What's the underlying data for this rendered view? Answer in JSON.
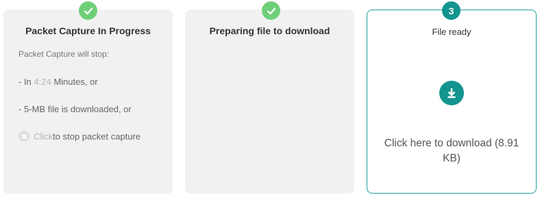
{
  "steps": [
    {
      "badge_icon": "checkmark-icon",
      "title": "Packet Capture In Progress",
      "lines": {
        "intro": "Packet Capture will stop:",
        "time_prefix": "- In ",
        "time_value": "4:24",
        "time_suffix": " Minutes, or",
        "size_text": "- 5-MB file is downloaded, or",
        "stop_link": "Click",
        "stop_suffix": " to stop packet capture"
      }
    },
    {
      "badge_icon": "checkmark-icon",
      "title": "Preparing file to download"
    },
    {
      "badge_number": "3",
      "title": "File ready",
      "download_icon": "download-icon",
      "download_text": "Click here to download (8.91 KB)"
    }
  ],
  "colors": {
    "completed_badge": "#6fcf78",
    "accent": "#13948f",
    "card_background": "#f1f1f1",
    "active_border": "#1f9e9a"
  }
}
